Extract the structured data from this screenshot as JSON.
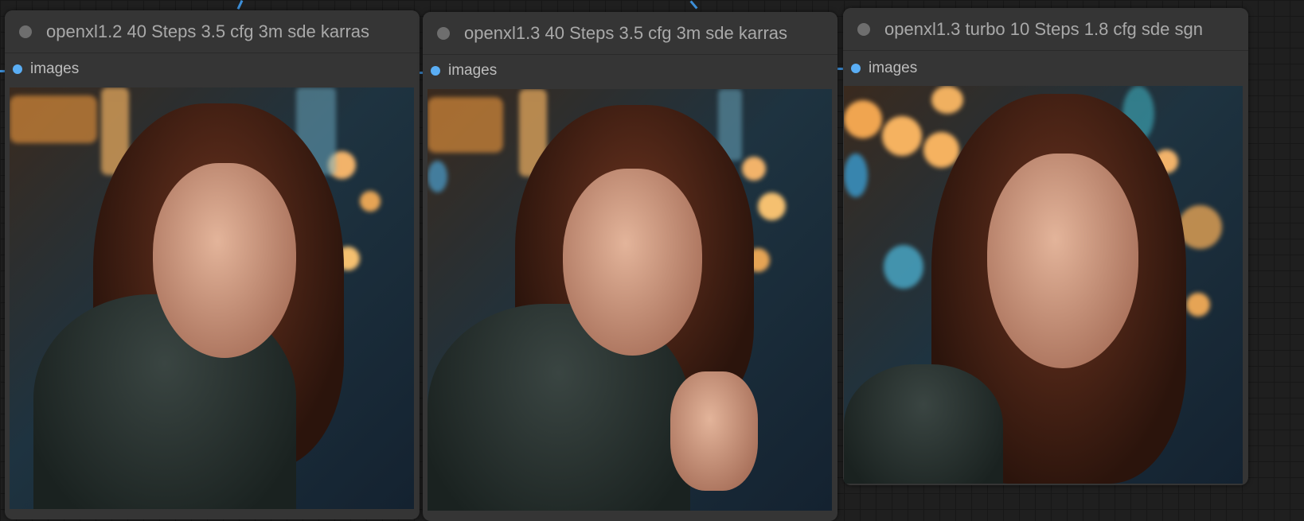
{
  "nodes": [
    {
      "title": "openxl1.2 40 Steps 3.5 cfg 3m sde karras",
      "output_label": "images",
      "image_alt": "generated portrait image"
    },
    {
      "title": "openxl1.3 40 Steps 3.5 cfg 3m sde karras",
      "output_label": "images",
      "image_alt": "generated portrait image"
    },
    {
      "title": "openxl1.3 turbo 10 Steps 1.8 cfg sde sgn",
      "output_label": "images",
      "image_alt": "generated portrait image"
    }
  ],
  "colors": {
    "slot": "#5aaef5",
    "wire": "#3d8fd8",
    "node_bg": "#353535",
    "canvas": "#1f1f1f"
  }
}
